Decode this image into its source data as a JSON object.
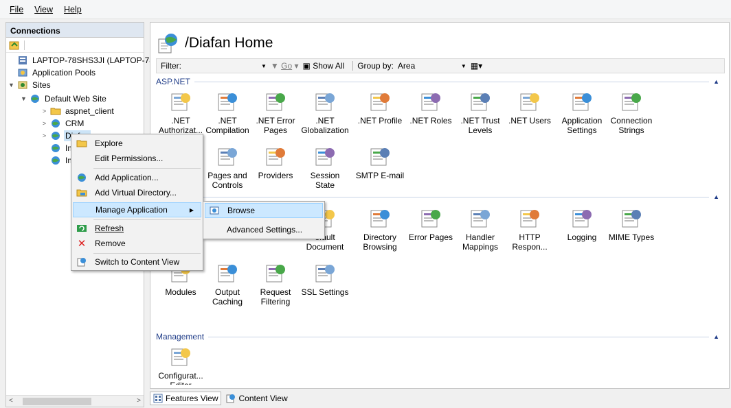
{
  "menubar": {
    "file": "File",
    "view": "View",
    "help": "Help"
  },
  "connections": {
    "header": "Connections",
    "tree": {
      "server": "LAPTOP-78SHS3JI (LAPTOP-78SH",
      "app_pools": "Application Pools",
      "sites": "Sites",
      "default_site": "Default Web Site",
      "aspnet_client": "aspnet_client",
      "crm": "CRM",
      "diafan": "Diafan",
      "im1": "Im",
      "im2": "Im"
    }
  },
  "main": {
    "title": "/Diafan Home",
    "filter": {
      "label": "Filter:",
      "go": "Go",
      "show_all": "Show All",
      "group_by_label": "Group by:",
      "group_by_value": "Area"
    },
    "groups": {
      "aspnet": "ASP.NET",
      "iis": "",
      "management": "Management"
    },
    "aspnet_features": [
      ".NET Authorizat...",
      ".NET Compilation",
      ".NET Error Pages",
      ".NET Globalization",
      ".NET Profile",
      ".NET Roles",
      ".NET Trust Levels",
      ".NET Users",
      "Application Settings",
      "Connection Strings",
      "Pages and Controls",
      "Providers",
      "Session State",
      "SMTP E-mail"
    ],
    "iis_features": [
      "efault Document",
      "Directory Browsing",
      "Error Pages",
      "Handler Mappings",
      "HTTP Respon...",
      "Logging",
      "MIME Types",
      "Modules",
      "Output Caching",
      "Request Filtering",
      "SSL Settings"
    ],
    "management_features": [
      "Configurat... Editor"
    ]
  },
  "bottom": {
    "features_view": "Features View",
    "content_view": "Content View"
  },
  "context_menu": {
    "explore": "Explore",
    "edit_permissions": "Edit Permissions...",
    "add_application": "Add Application...",
    "add_virtual_directory": "Add Virtual Directory...",
    "manage_application": "Manage Application",
    "refresh": "Refresh",
    "remove": "Remove",
    "switch_content_view": "Switch to Content View"
  },
  "submenu": {
    "browse": "Browse",
    "advanced_settings": "Advanced Settings..."
  },
  "colors": {
    "accent": "#1f3c88",
    "highlight": "#cce8ff"
  }
}
